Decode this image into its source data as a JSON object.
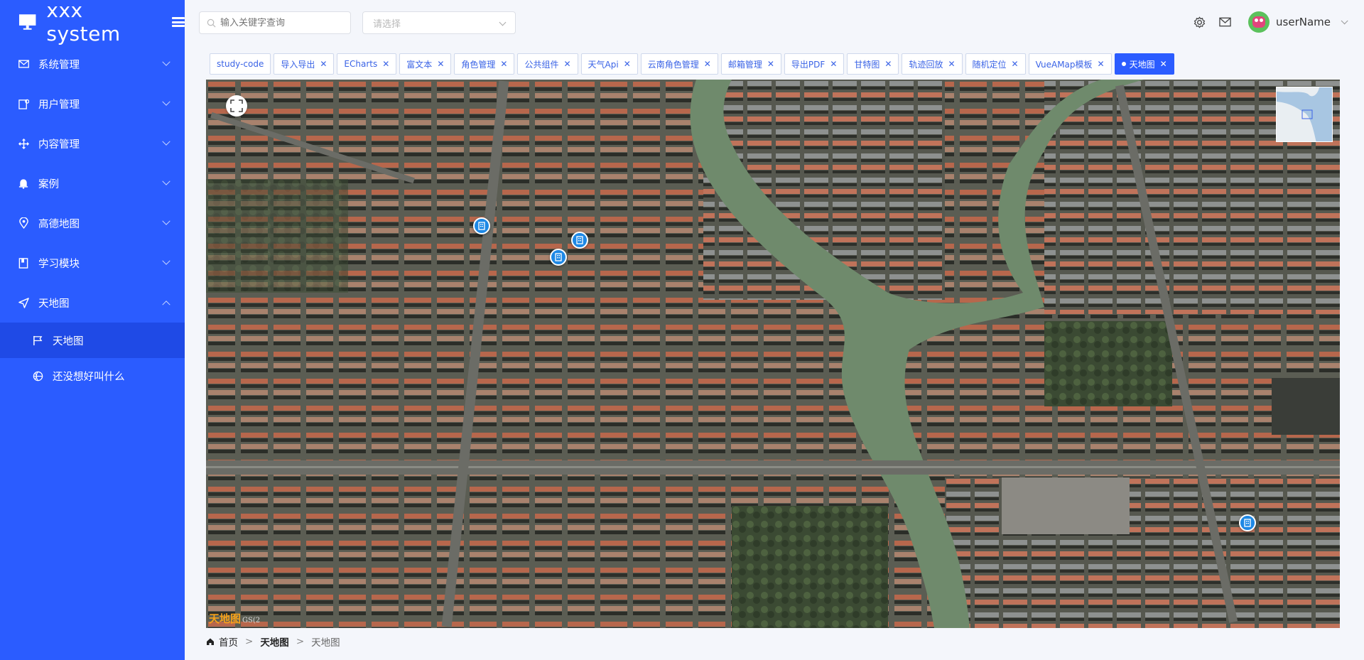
{
  "app": {
    "title": "xxx system"
  },
  "sidebar": {
    "items": [
      {
        "label": "系统管理",
        "icon": "mail-icon"
      },
      {
        "label": "用户管理",
        "icon": "user-card-icon"
      },
      {
        "label": "内容管理",
        "icon": "move-icon"
      },
      {
        "label": "案例",
        "icon": "bell-icon"
      },
      {
        "label": "高德地图",
        "icon": "location-pin-icon"
      },
      {
        "label": "学习模块",
        "icon": "book-icon"
      },
      {
        "label": "天地图",
        "icon": "navigation-arrow-icon",
        "expanded": true
      }
    ],
    "subitems": [
      {
        "label": "天地图",
        "icon": "flag-icon",
        "active": true
      },
      {
        "label": "还没想好叫什么",
        "icon": "basketball-icon"
      }
    ]
  },
  "header": {
    "search_placeholder": "输入关键字查询",
    "select_placeholder": "请选择",
    "username": "userName"
  },
  "tabs": [
    {
      "label": "study-code",
      "closable": false
    },
    {
      "label": "导入导出",
      "closable": true
    },
    {
      "label": "ECharts",
      "closable": true
    },
    {
      "label": "富文本",
      "closable": true
    },
    {
      "label": "角色管理",
      "closable": true
    },
    {
      "label": "公共组件",
      "closable": true
    },
    {
      "label": "天气Api",
      "closable": true
    },
    {
      "label": "云南角色管理",
      "closable": true
    },
    {
      "label": "邮箱管理",
      "closable": true
    },
    {
      "label": "导出PDF",
      "closable": true
    },
    {
      "label": "甘特图",
      "closable": true
    },
    {
      "label": "轨迹回放",
      "closable": true
    },
    {
      "label": "随机定位",
      "closable": true
    },
    {
      "label": "VueAMap模板",
      "closable": true
    },
    {
      "label": "天地图",
      "closable": true,
      "active": true
    }
  ],
  "map": {
    "logo_text": "天地图",
    "logo_sub": "GS(2"
  },
  "breadcrumb": {
    "home": "首页",
    "level1": "天地图",
    "level2": "天地图"
  },
  "colors": {
    "sidebar_bg": "#2b5cff",
    "active_sub_bg": "#1f4ae6",
    "marker": "#1e88e5",
    "tab_text": "#3a63e6"
  }
}
